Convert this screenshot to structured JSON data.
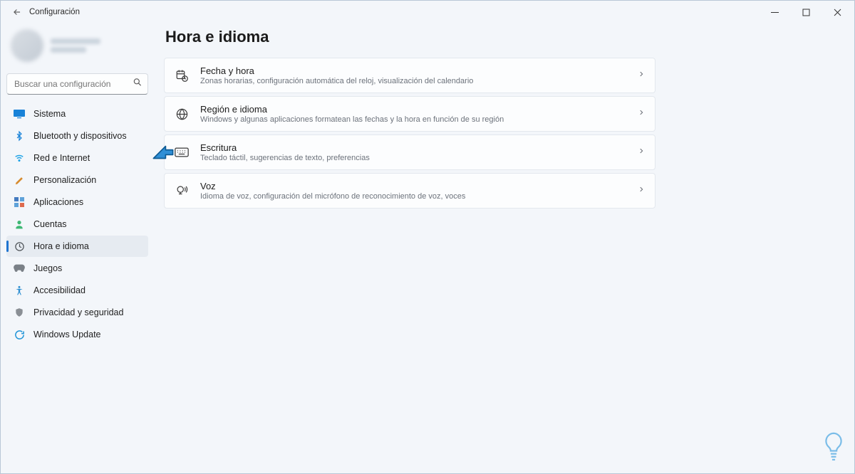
{
  "window": {
    "title": "Configuración"
  },
  "search": {
    "placeholder": "Buscar una configuración"
  },
  "sidebar": {
    "items": [
      {
        "label": "Sistema"
      },
      {
        "label": "Bluetooth y dispositivos"
      },
      {
        "label": "Red e Internet"
      },
      {
        "label": "Personalización"
      },
      {
        "label": "Aplicaciones"
      },
      {
        "label": "Cuentas"
      },
      {
        "label": "Hora e idioma"
      },
      {
        "label": "Juegos"
      },
      {
        "label": "Accesibilidad"
      },
      {
        "label": "Privacidad y seguridad"
      },
      {
        "label": "Windows Update"
      }
    ],
    "active_index": 6
  },
  "main": {
    "title": "Hora e idioma",
    "cards": [
      {
        "title": "Fecha y hora",
        "sub": "Zonas horarias, configuración automática del reloj, visualización del calendario"
      },
      {
        "title": "Región e idioma",
        "sub": "Windows y algunas aplicaciones formatean las fechas y la hora en función de su región"
      },
      {
        "title": "Escritura",
        "sub": "Teclado táctil, sugerencias de texto, preferencias"
      },
      {
        "title": "Voz",
        "sub": "Idioma de voz, configuración del micrófono de reconocimiento de voz, voces"
      }
    ]
  }
}
